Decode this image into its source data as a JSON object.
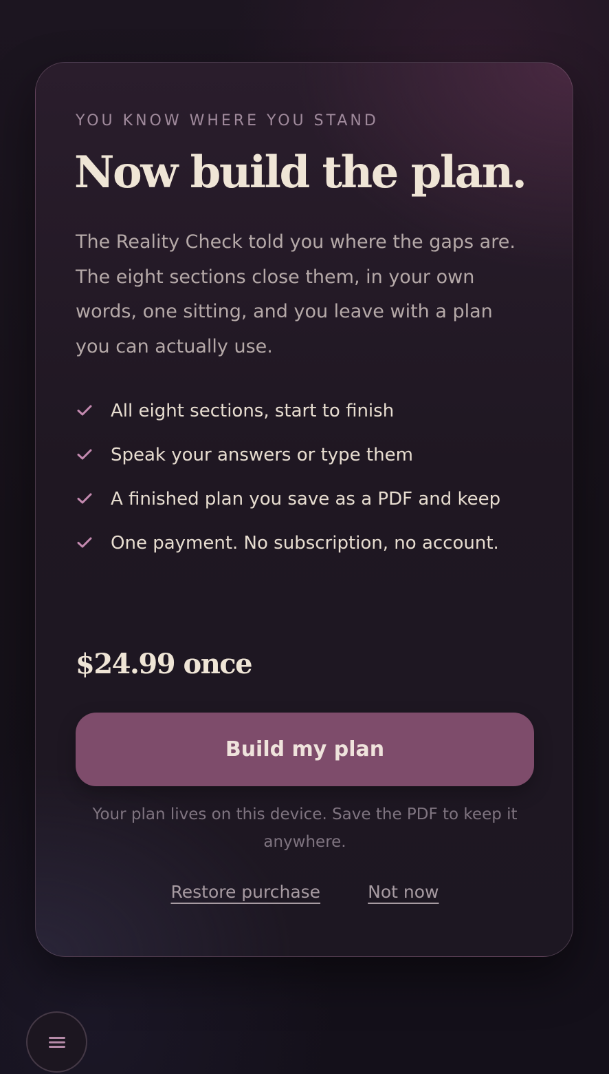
{
  "paywall": {
    "eyebrow": "YOU KNOW WHERE YOU STAND",
    "headline": "Now build the plan.",
    "intro": "The Reality Check told you where the gaps are. The eight sections close them, in your own words, one sitting, and you leave with a plan you can actually use.",
    "features": [
      {
        "icon": "check-icon",
        "text": "All eight sections, start to finish"
      },
      {
        "icon": "check-icon",
        "text": "Speak your answers or type them"
      },
      {
        "icon": "check-icon",
        "text": "A finished plan you save as a PDF and keep"
      },
      {
        "icon": "check-icon",
        "text": "One payment. No subscription, no account."
      }
    ],
    "price": "$24.99 once",
    "cta_label": "Build my plan",
    "note": "Your plan lives on this device. Save the PDF to keep it anywhere.",
    "restore_label": "Restore purchase",
    "dismiss_label": "Not now"
  },
  "menu": {
    "icon": "hamburger-menu-icon"
  },
  "colors": {
    "background": "#161119",
    "card": "#241a27",
    "accent": "#7e4c6b",
    "check": "#c48ab0",
    "heading": "#efe5d6",
    "muted": "#a08a9c"
  }
}
